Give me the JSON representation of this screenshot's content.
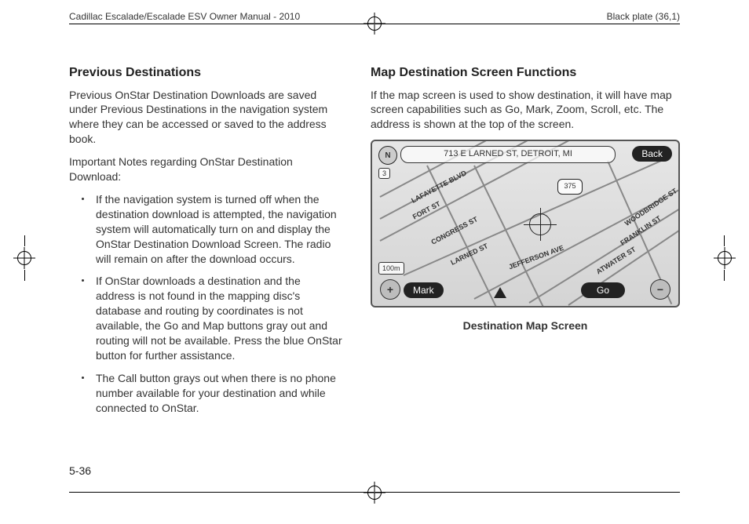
{
  "header": {
    "manual_title": "Cadillac Escalade/Escalade ESV Owner Manual - 2010",
    "plate": "Black plate (36,1)"
  },
  "left": {
    "heading": "Previous Destinations",
    "p1": "Previous OnStar Destination Downloads are saved under Previous Destinations in the navigation system where they can be accessed or saved to the address book.",
    "p2": "Important Notes regarding OnStar Destination Download:",
    "bullets": [
      "If the navigation system is turned off when the destination download is attempted, the navigation system will automatically turn on and display the OnStar Destination Download Screen. The radio will remain on after the download occurs.",
      "If OnStar downloads a destination and the address is not found in the mapping disc's database and routing by coordinates is not available, the Go and Map buttons gray out and routing will not be available. Press the blue OnStar button for further assistance.",
      "The Call button grays out when there is no phone number available for your destination and while connected to OnStar."
    ]
  },
  "right": {
    "heading": "Map Destination Screen Functions",
    "p1": "If the map screen is used to show destination, it will have map screen capabilities such as Go, Mark, Zoom, Scroll, etc. The address is shown at the top of the screen.",
    "caption": "Destination Map Screen"
  },
  "map": {
    "address": "713 E LARNED ST, DETROIT, MI",
    "back": "Back",
    "mark": "Mark",
    "go": "Go",
    "north": "N",
    "scale": "100m",
    "three": "3",
    "route_shield": "375",
    "zoom_in": "+",
    "zoom_out": "−",
    "streets": {
      "lafayette": "LAFAYETTE BLVD",
      "fort": "FORT ST",
      "congress": "CONGRESS ST",
      "larned": "LARNED ST",
      "jefferson": "JEFFERSON AVE",
      "atwater": "ATWATER ST",
      "franklin": "FRANKLIN ST",
      "woodbridge": "WOODBRIDGE ST"
    }
  },
  "page_number": "5-36"
}
